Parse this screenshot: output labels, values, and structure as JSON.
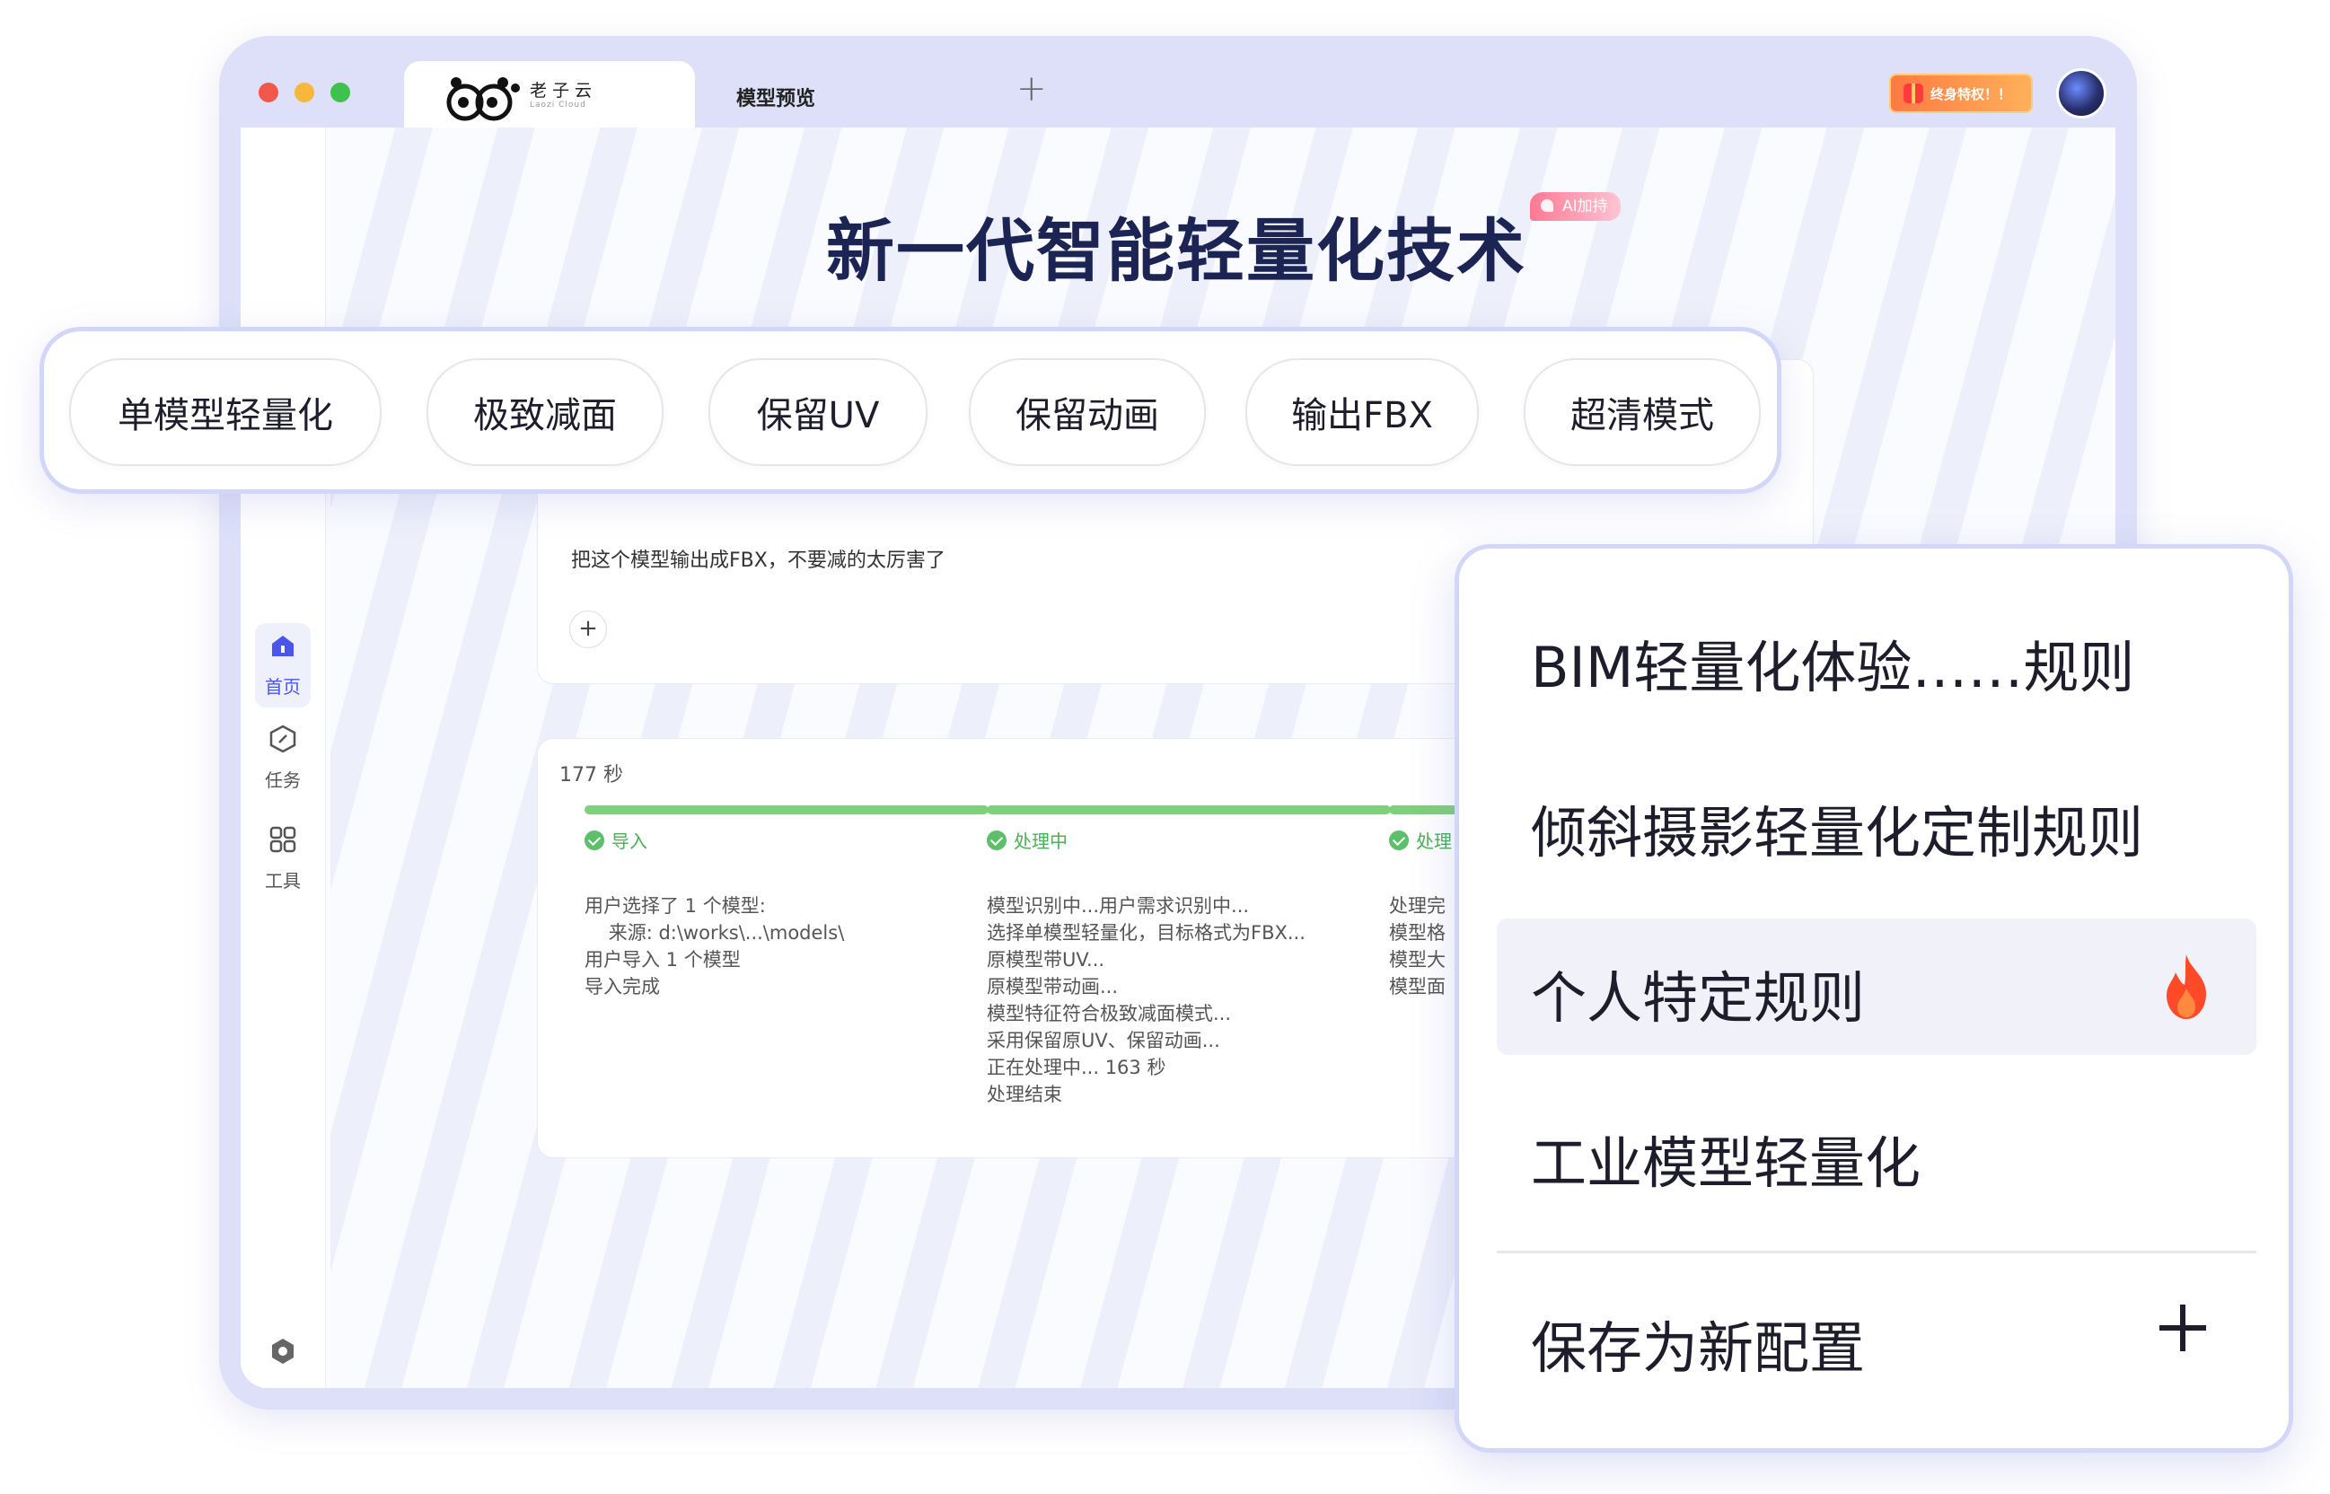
{
  "window": {
    "logo_text": "老子云",
    "logo_sub": "Laozi Cloud",
    "tab2_label": "模型预览",
    "new_tab": "+",
    "vip_label": "终身特权！！"
  },
  "sidebar": {
    "items": [
      {
        "label": "首页",
        "icon": "home-icon"
      },
      {
        "label": "任务",
        "icon": "task-icon"
      },
      {
        "label": "工具",
        "icon": "tools-icon"
      }
    ],
    "settings_icon": "settings-icon"
  },
  "hero": {
    "title": "新一代智能轻量化技术",
    "badge": "AI加持"
  },
  "chat": {
    "message": "把这个模型输出成FBX，不要减的太厉害了",
    "add_button": "+"
  },
  "process": {
    "timer": "177 秒",
    "stages": [
      {
        "label": "导入",
        "lines": "用户选择了 1 个模型:\n    来源: d:\\works\\...\\models\\\n用户导入 1 个模型\n导入完成"
      },
      {
        "label": "处理中",
        "lines": "模型识别中...用户需求识别中...\n选择单模型轻量化，目标格式为FBX...\n原模型带UV...\n原模型带动画...\n模型特征符合极致减面模式...\n采用保留原UV、保留动画...\n正在处理中... 163 秒\n处理结束"
      },
      {
        "label": "处理",
        "lines": "处理完\n模型格\n模型大\n模型面"
      }
    ]
  },
  "options": [
    "单模型轻量化",
    "极致减面",
    "保留UV",
    "保留动画",
    "输出FBX",
    "超清模式"
  ],
  "rules": {
    "items": [
      "BIM轻量化体验……规则",
      "倾斜摄影轻量化定制规则",
      "个人特定规则",
      "工业模型轻量化"
    ],
    "selected_index": 2,
    "selected_icon": "flame-icon",
    "save_label": "保存为新配置",
    "save_icon": "plus-icon"
  },
  "colors": {
    "accent": "#4a56e8",
    "frame": "#dde0f8",
    "success": "#5cc06a",
    "hot": "#ff4a2a"
  }
}
